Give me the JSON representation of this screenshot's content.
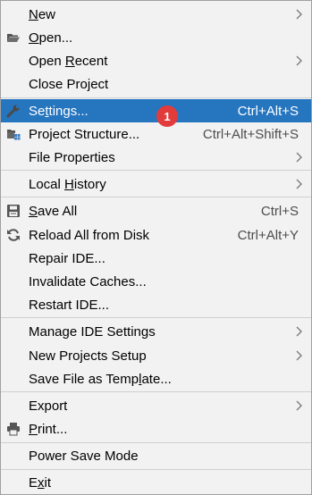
{
  "menu": {
    "items": [
      {
        "label": "New",
        "pre": "",
        "u": "N",
        "post": "ew"
      },
      {
        "label": "Open...",
        "pre": "",
        "u": "O",
        "post": "pen..."
      },
      {
        "label": "Open Recent",
        "pre": "Open ",
        "u": "R",
        "post": "ecent"
      },
      {
        "label": "Close Project"
      },
      {
        "label": "Settings...",
        "pre": "Se",
        "u": "t",
        "post": "tings...",
        "shortcut": "Ctrl+Alt+S"
      },
      {
        "label": "Project Structure...",
        "shortcut": "Ctrl+Alt+Shift+S"
      },
      {
        "label": "File Properties"
      },
      {
        "label": "Local History",
        "pre": "Local ",
        "u": "H",
        "post": "istory"
      },
      {
        "label": "Save All",
        "pre": "",
        "u": "S",
        "post": "ave All",
        "shortcut": "Ctrl+S"
      },
      {
        "label": "Reload All from Disk",
        "shortcut": "Ctrl+Alt+Y"
      },
      {
        "label": "Repair IDE..."
      },
      {
        "label": "Invalidate Caches..."
      },
      {
        "label": "Restart IDE..."
      },
      {
        "label": "Manage IDE Settings"
      },
      {
        "label": "New Projects Setup"
      },
      {
        "label": "Save File as Template...",
        "pre": "Save File as Temp",
        "u": "l",
        "post": "ate..."
      },
      {
        "label": "Export"
      },
      {
        "label": "Print...",
        "pre": "",
        "u": "P",
        "post": "rint..."
      },
      {
        "label": "Power Save Mode"
      },
      {
        "label": "Exit",
        "pre": "E",
        "u": "x",
        "post": "it"
      }
    ],
    "selected_label": "Settings...",
    "badge": "1",
    "icons": {
      "open": "folder-icon",
      "settings": "wrench-icon",
      "project_structure": "project-structure-icon",
      "save_all": "save-icon",
      "reload": "reload-icon",
      "print": "printer-icon",
      "submenu": "chevron-right-icon"
    },
    "colors": {
      "background": "#f2f2f2",
      "selection": "#2675bf",
      "badge": "#e23b3b",
      "separator": "#cfcfcf"
    }
  }
}
